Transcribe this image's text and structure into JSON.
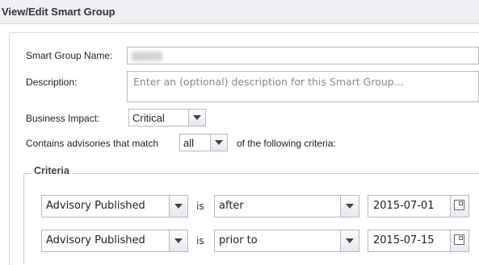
{
  "window": {
    "title": "View/Edit Smart Group"
  },
  "form": {
    "name_label": "Smart Group Name:",
    "description_label": "Description:",
    "description_placeholder": "Enter an (optional) description for this Smart Group...",
    "impact_label": "Business Impact:",
    "impact_value": "Critical",
    "match_prefix": "Contains advisories that match",
    "match_value": "all",
    "match_suffix": "of the following criteria:"
  },
  "criteria": {
    "legend": "Criteria",
    "rows": [
      {
        "field": "Advisory Published",
        "operator_word": "is",
        "comparison": "after",
        "date": "2015-07-01"
      },
      {
        "field": "Advisory Published",
        "operator_word": "is",
        "comparison": "prior to",
        "date": "2015-07-15"
      }
    ]
  },
  "icons": {
    "dropdown": "chevron-down-icon",
    "calendar": "calendar-icon"
  },
  "colors": {
    "header_bg": "#eef0f3",
    "field_border": "#b5b8c8",
    "placeholder_text": "#8a8a8a"
  }
}
